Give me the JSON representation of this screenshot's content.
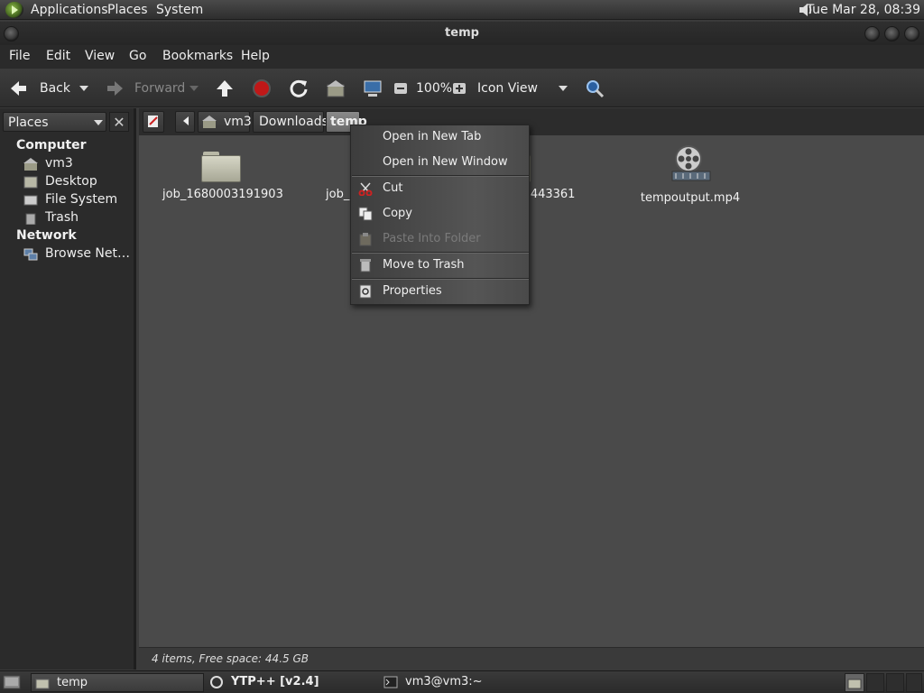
{
  "top_panel": {
    "menus": [
      "Applications",
      "Places",
      "System"
    ],
    "clock": "Tue Mar 28, 08:39"
  },
  "window": {
    "title": "temp"
  },
  "menubar": [
    "File",
    "Edit",
    "View",
    "Go",
    "Bookmarks",
    "Help"
  ],
  "toolbar": {
    "back_label": "Back",
    "forward_label": "Forward",
    "zoom": "100%",
    "view_mode": "Icon View"
  },
  "sidebar": {
    "selector_label": "Places",
    "sections": [
      {
        "heading": "Computer",
        "items": [
          "vm3",
          "Desktop",
          "File System",
          "Trash"
        ]
      },
      {
        "heading": "Network",
        "items": [
          "Browse Net…"
        ]
      }
    ]
  },
  "pathbar": {
    "crumbs": [
      "vm3",
      "Downloads",
      "temp"
    ]
  },
  "files": [
    {
      "name": "job_1680003191903",
      "type": "folder"
    },
    {
      "name": "job_1",
      "type": "folder"
    },
    {
      "name": "004443361",
      "type": "folder"
    },
    {
      "name": "tempoutput.mp4",
      "type": "video"
    }
  ],
  "status": "4 items, Free space: 44.5 GB",
  "context_menu": {
    "items": [
      {
        "label": "Open in New Tab",
        "icon": "none",
        "enabled": true
      },
      {
        "label": "Open in New Window",
        "icon": "none",
        "enabled": true
      },
      {
        "label": "Cut",
        "icon": "scissors-icon",
        "enabled": true
      },
      {
        "label": "Copy",
        "icon": "copy-icon",
        "enabled": true
      },
      {
        "label": "Paste Into Folder",
        "icon": "paste-icon",
        "enabled": false
      },
      {
        "label": "Move to Trash",
        "icon": "trash-icon",
        "enabled": true
      },
      {
        "label": "Properties",
        "icon": "properties-icon",
        "enabled": true
      }
    ]
  },
  "taskbar": {
    "tasks": [
      "temp",
      "YTP++ [v2.4]",
      "vm3@vm3:~"
    ]
  },
  "colors": {
    "background": "#4a4a4a",
    "sidebar": "#2b2b2b",
    "panel": "#2e2e2e",
    "cut_icon": "#cc2222",
    "stop_icon": "#c01818"
  }
}
